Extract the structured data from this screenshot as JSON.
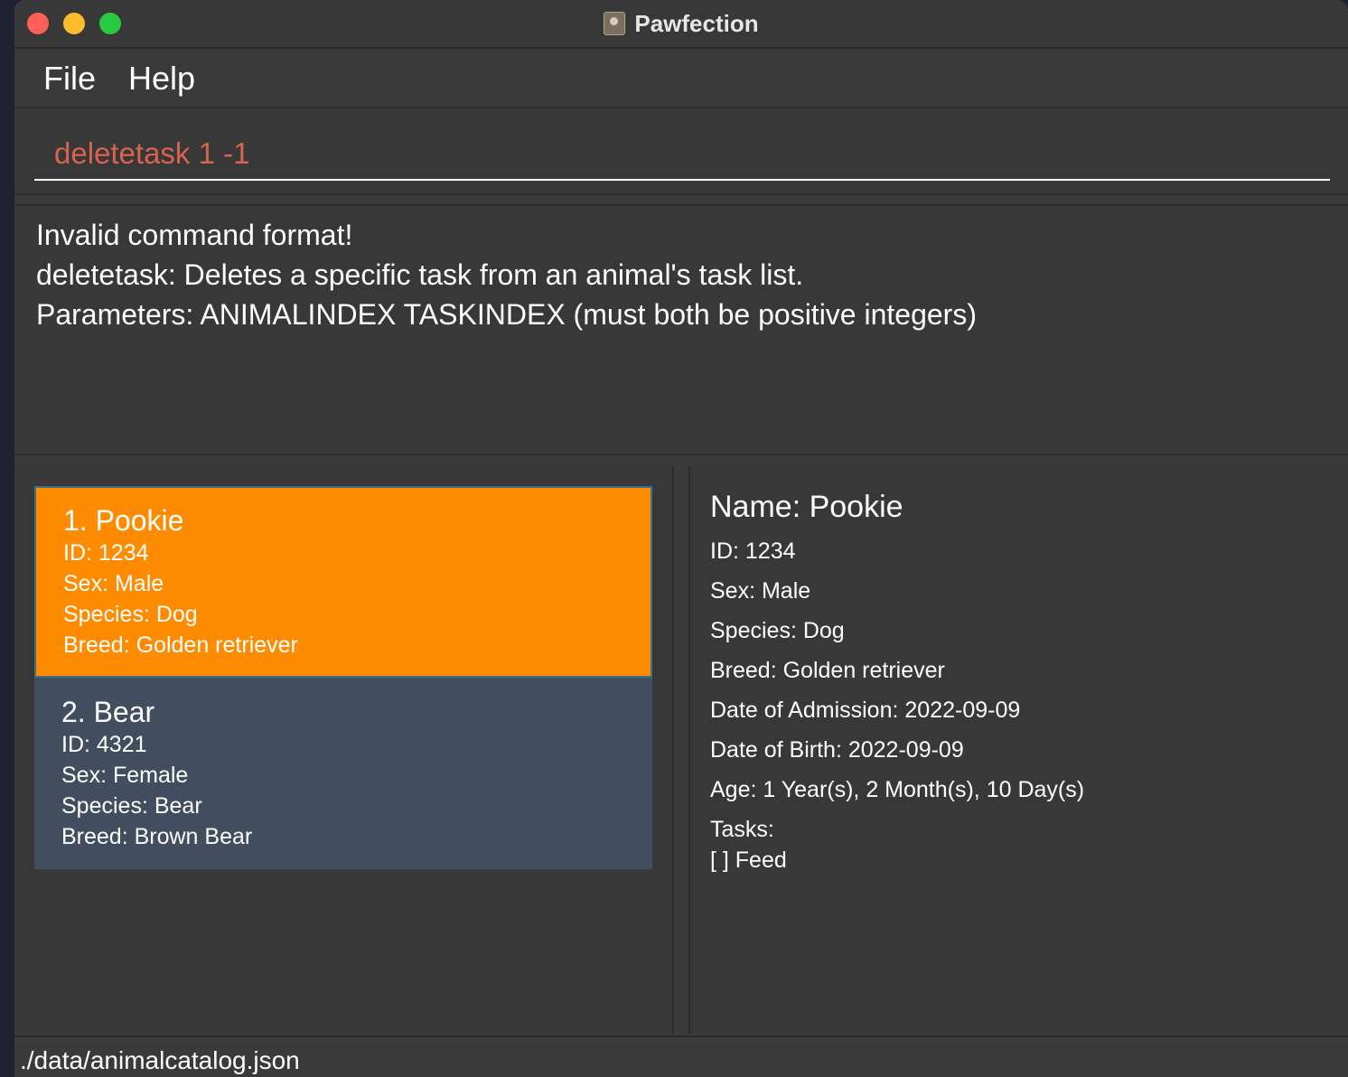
{
  "window": {
    "title": "Pawfection"
  },
  "menu": {
    "items": [
      "File",
      "Help"
    ]
  },
  "command_box": {
    "value": "deletetask 1 -1"
  },
  "result_display": {
    "lines": [
      "Invalid command format!",
      "deletetask: Deletes a specific task from an animal's task list.",
      "Parameters: ANIMALINDEX TASKINDEX (must both be positive integers)"
    ]
  },
  "animal_list": [
    {
      "title": "1.  Pookie",
      "id": "ID: 1234",
      "sex": "Sex: Male",
      "species": "Species: Dog",
      "breed": "Breed: Golden retriever",
      "selected": true
    },
    {
      "title": "2.  Bear",
      "id": "ID: 4321",
      "sex": "Sex: Female",
      "species": "Species: Bear",
      "breed": "Breed: Brown Bear",
      "selected": false
    }
  ],
  "detail": {
    "name": "Name: Pookie",
    "id": "ID: 1234",
    "sex": "Sex: Male",
    "species": "Species: Dog",
    "breed": "Breed: Golden retriever",
    "admission": "Date of Admission: 2022-09-09",
    "birth": "Date of Birth: 2022-09-09",
    "age": "Age: 1 Year(s), 2 Month(s), 10 Day(s)",
    "tasks_label": "Tasks:",
    "tasks": [
      "[ ] Feed"
    ]
  },
  "status_bar": {
    "path": "./data/animalcatalog.json"
  },
  "colors": {
    "selected_card": "#ff8c00",
    "card": "#424d60",
    "command_text": "#d8634f",
    "window_bg": "#383838"
  }
}
